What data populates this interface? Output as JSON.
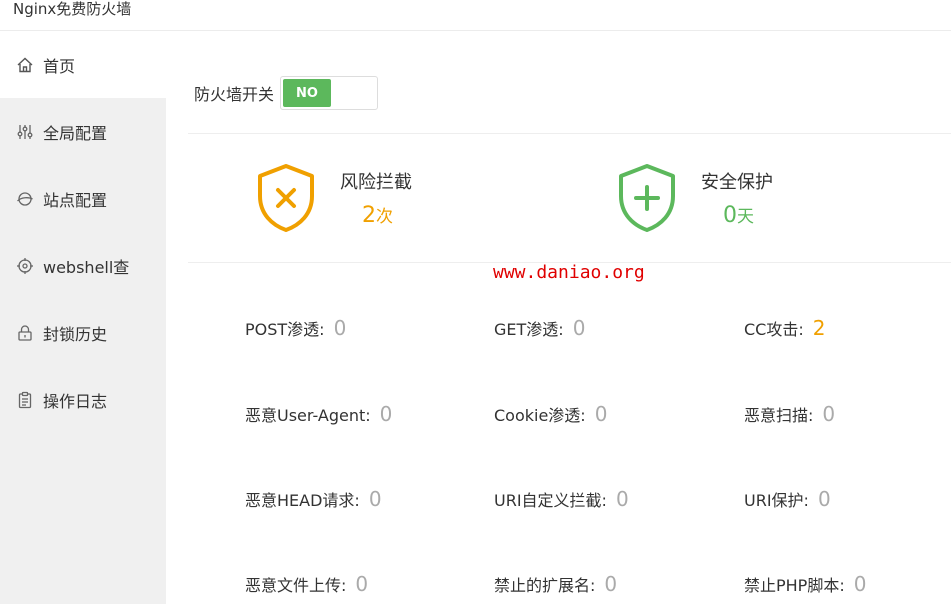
{
  "window": {
    "title": "Nginx免费防火墙"
  },
  "sidebar": {
    "items": [
      {
        "label": "首页",
        "icon": "home-icon",
        "active": true
      },
      {
        "label": "全局配置",
        "icon": "sliders-icon"
      },
      {
        "label": "站点配置",
        "icon": "globe-icon"
      },
      {
        "label": "webshell查",
        "icon": "target-icon"
      },
      {
        "label": "封锁历史",
        "icon": "lock-icon"
      },
      {
        "label": "操作日志",
        "icon": "clipboard-icon"
      }
    ]
  },
  "firewall": {
    "label": "防火墙开关",
    "toggle_text": "NO"
  },
  "stats": {
    "risk": {
      "title": "风险拦截",
      "value": "2",
      "unit": "次",
      "color": "#f0a000",
      "icon": "shield-x-icon"
    },
    "safe": {
      "title": "安全保护",
      "value": "0",
      "unit": "天",
      "color": "#5cb85c",
      "icon": "shield-plus-icon"
    }
  },
  "watermark": "www.daniao.org",
  "metrics": [
    {
      "label": "POST渗透:",
      "value": "0"
    },
    {
      "label": "GET渗透:",
      "value": "0"
    },
    {
      "label": "CC攻击:",
      "value": "2",
      "highlight": true
    },
    {
      "label": "恶意User-Agent:",
      "value": "0"
    },
    {
      "label": "Cookie渗透:",
      "value": "0"
    },
    {
      "label": "恶意扫描:",
      "value": "0"
    },
    {
      "label": "恶意HEAD请求:",
      "value": "0"
    },
    {
      "label": "URI自定义拦截:",
      "value": "0"
    },
    {
      "label": "URI保护:",
      "value": "0"
    },
    {
      "label": "恶意文件上传:",
      "value": "0"
    },
    {
      "label": "禁止的扩展名:",
      "value": "0"
    },
    {
      "label": "禁止PHP脚本:",
      "value": "0"
    }
  ]
}
